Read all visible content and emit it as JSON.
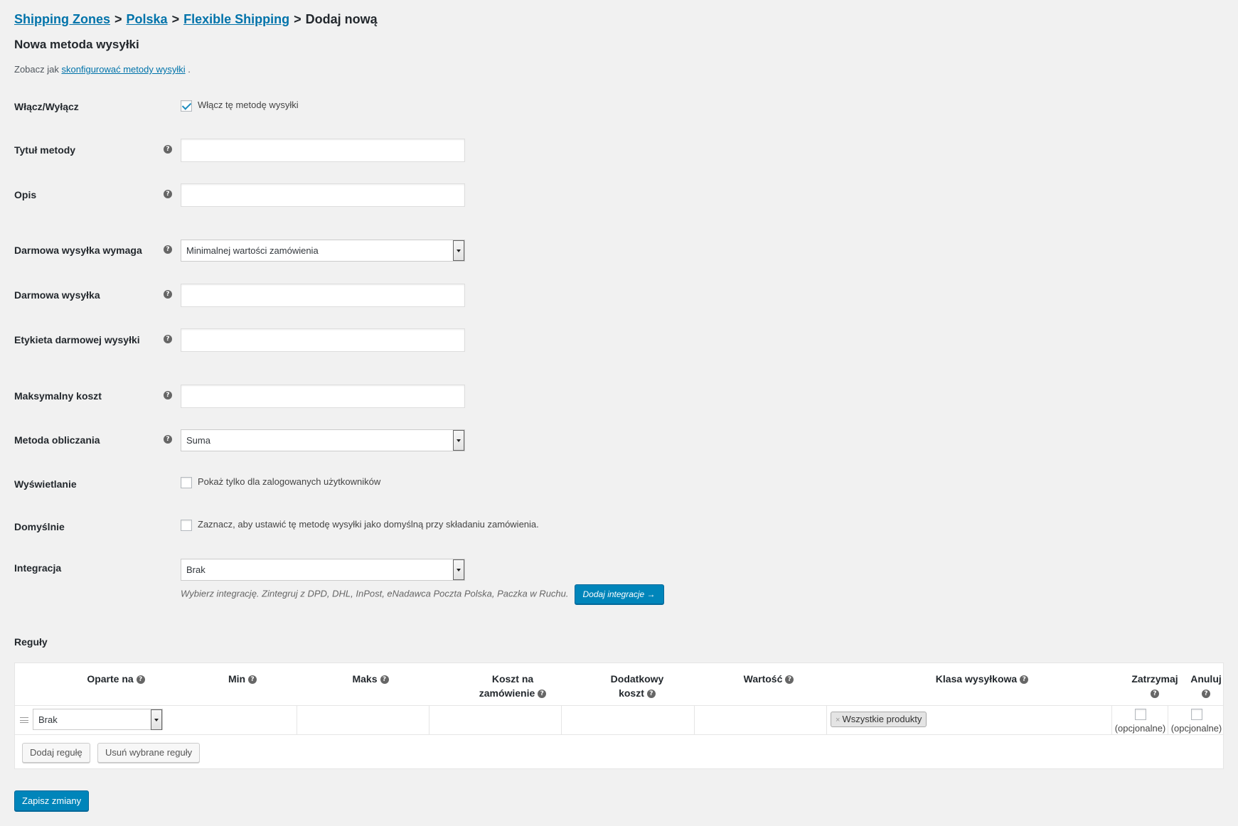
{
  "breadcrumb": {
    "items": [
      "Shipping Zones",
      "Polska",
      "Flexible Shipping"
    ],
    "separator": ">",
    "current": "Dodaj nową"
  },
  "page_title": "Nowa metoda wysyłki",
  "intro": {
    "prefix": "Zobacz jak",
    "link": "skonfigurować metody wysyłki",
    "suffix": "."
  },
  "form": {
    "enable": {
      "label": "Włącz/Wyłącz",
      "checkbox_label": "Włącz tę metodę wysyłki",
      "checked": true
    },
    "title": {
      "label": "Tytuł metody",
      "value": ""
    },
    "description": {
      "label": "Opis",
      "value": ""
    },
    "free_shipping_requires": {
      "label": "Darmowa wysyłka wymaga",
      "value": "Minimalnej wartości zamówienia"
    },
    "free_shipping": {
      "label": "Darmowa wysyłka",
      "value": ""
    },
    "free_shipping_label": {
      "label": "Etykieta darmowej wysyłki",
      "value": ""
    },
    "max_cost": {
      "label": "Maksymalny koszt",
      "value": ""
    },
    "calc_method": {
      "label": "Metoda obliczania",
      "value": "Suma"
    },
    "display": {
      "label": "Wyświetlanie",
      "checkbox_label": "Pokaż tylko dla zalogowanych użytkowników",
      "checked": false
    },
    "default": {
      "label": "Domyślnie",
      "checkbox_label": "Zaznacz, aby ustawić tę metodę wysyłki jako domyślną przy składaniu zamówienia.",
      "checked": false
    },
    "integration": {
      "label": "Integracja",
      "value": "Brak",
      "description": "Wybierz integrację. Zintegruj z DPD, DHL, InPost, eNadawca Poczta Polska, Paczka w Ruchu.",
      "button": "Dodaj integracje →"
    }
  },
  "rules": {
    "title": "Reguły",
    "headers": {
      "based_on": "Oparte na",
      "min": "Min",
      "max": "Maks",
      "cost_per_order_1": "Koszt na",
      "cost_per_order_2": "zamówienie",
      "extra_cost_1": "Dodatkowy",
      "extra_cost_2": "koszt",
      "value": "Wartość",
      "shipping_class": "Klasa wysyłkowa",
      "stop": "Zatrzymaj",
      "cancel": "Anuluj"
    },
    "row": {
      "based_on": "Brak",
      "shipping_class_tag": "Wszystkie produkty",
      "tag_remove": "×",
      "stop_optional": "(opcjonalne)",
      "cancel_optional": "(opcjonalne)"
    },
    "add_button": "Dodaj regułę",
    "remove_button": "Usuń wybrane reguły"
  },
  "save_button": "Zapisz zmiany",
  "colors": {
    "accent": "#0085ba",
    "link": "#0073aa",
    "background": "#f1f1f1"
  }
}
